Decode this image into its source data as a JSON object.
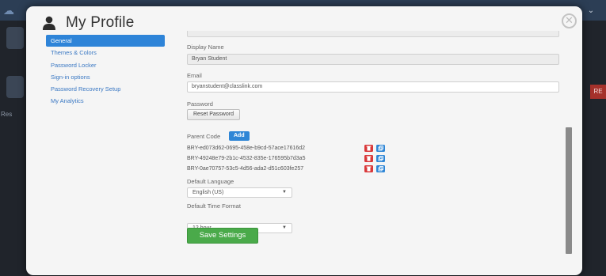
{
  "background": {
    "bg_left_text": "Res",
    "bg_red_label": "RE"
  },
  "modal": {
    "title": "My Profile",
    "close_symbol": "✕"
  },
  "sidebar": {
    "items": [
      {
        "label": "General",
        "active": true
      },
      {
        "label": "Themes & Colors",
        "active": false
      },
      {
        "label": "Password Locker",
        "active": false
      },
      {
        "label": "Sign-in options",
        "active": false
      },
      {
        "label": "Password Recovery Setup",
        "active": false
      },
      {
        "label": "My Analytics",
        "active": false
      }
    ]
  },
  "form": {
    "display_name_label": "Display Name",
    "display_name_value": "Bryan Student",
    "email_label": "Email",
    "email_value": "bryanstudent@classlink.com",
    "password_label": "Password",
    "reset_password_label": "Reset Password",
    "parent_code_label": "Parent Code",
    "add_label": "Add",
    "parent_codes": [
      "BRY-ed073d62-0695-458e-b9cd-57ace17616d2",
      "BRY-49248e79-2b1c-4532-835e-176595b7d3a5",
      "BRY-0ae70757-53c5-4d56-ada2-d51c603fe257"
    ],
    "default_language_label": "Default Language",
    "default_language_value": "English (US)",
    "default_time_format_label": "Default Time Format",
    "default_time_format_value": "12 hour",
    "save_label": "Save Settings"
  },
  "colors": {
    "accent": "#2e84d8",
    "save": "#4aaa4a",
    "delete": "#d9383a"
  }
}
